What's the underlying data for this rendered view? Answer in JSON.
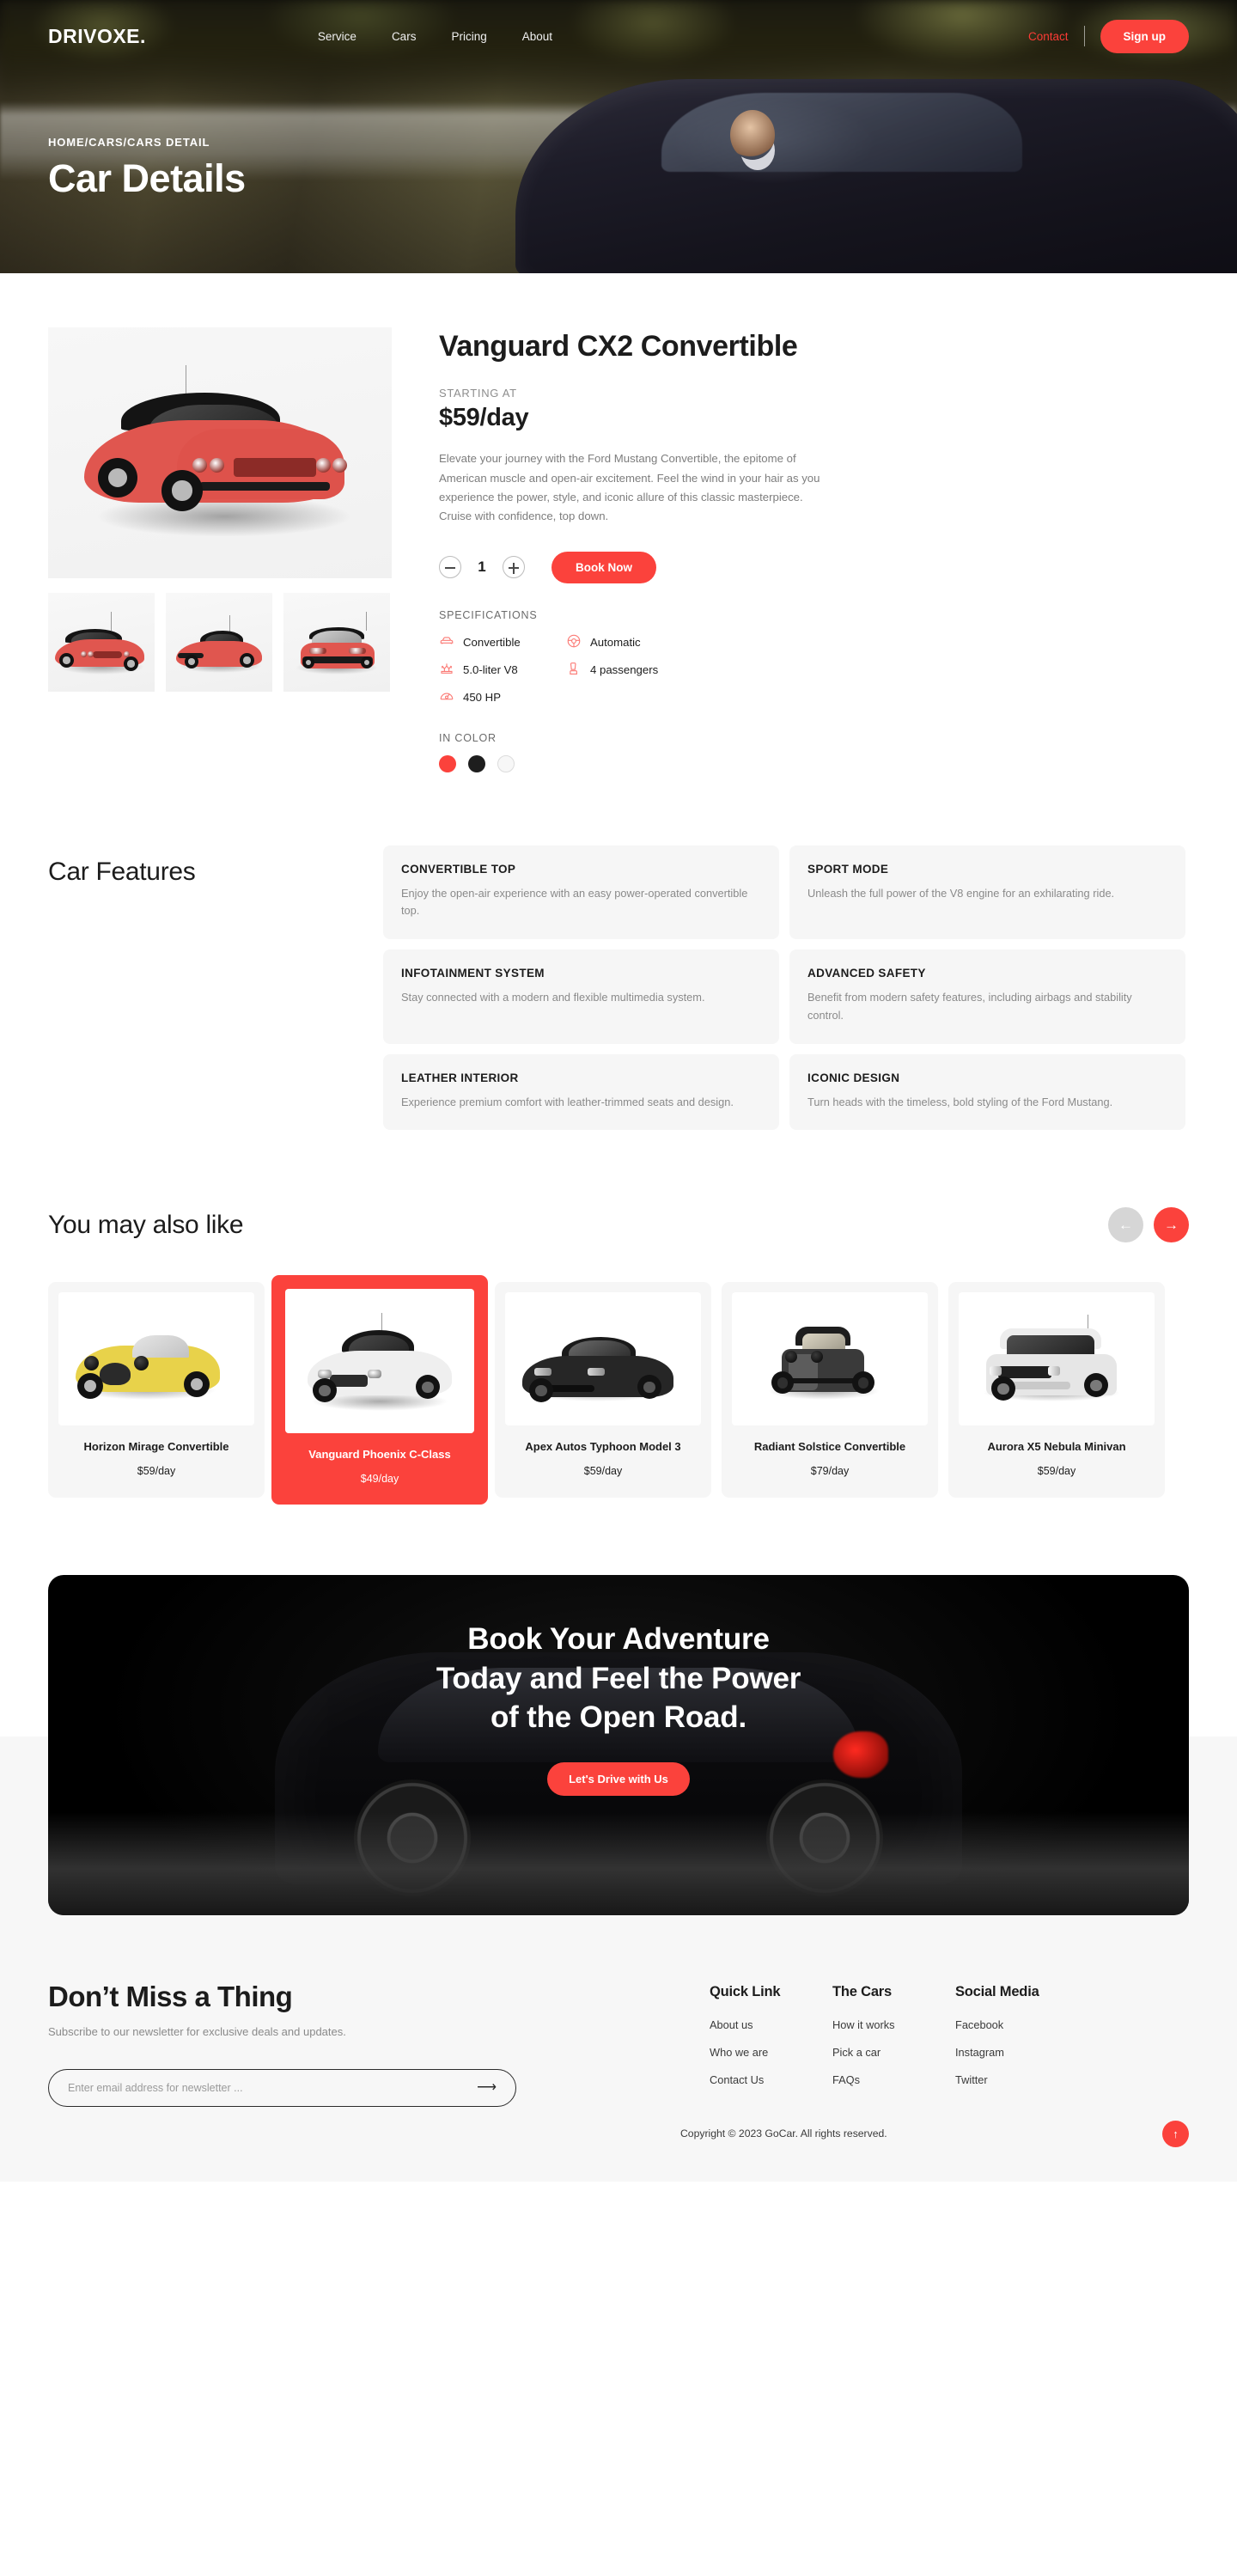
{
  "nav": {
    "logo": "DRIVOXE.",
    "links": [
      {
        "label": "Service"
      },
      {
        "label": "Cars"
      },
      {
        "label": "Pricing"
      },
      {
        "label": "About"
      }
    ],
    "contact_label": "Contact",
    "signup_label": "Sign up"
  },
  "hero": {
    "breadcrumb": "HOME/CARS/CARS DETAIL",
    "title": "Car Details"
  },
  "product": {
    "title": "Vanguard CX2 Convertible",
    "starting_label": "STARTING AT",
    "price": "$59/day",
    "description": "Elevate your journey with the Ford Mustang Convertible, the epitome of American muscle and open-air excitement. Feel the wind in your hair as you experience the power, style, and iconic allure of this classic masterpiece. Cruise with confidence, top down.",
    "quantity": "1",
    "book_label": "Book Now",
    "specs_label": "SPECIFICATIONS",
    "specs": [
      {
        "icon": "car-icon",
        "label": "Convertible"
      },
      {
        "icon": "steering-wheel-icon",
        "label": "Automatic"
      },
      {
        "icon": "engine-icon",
        "label": "5.0-liter V8"
      },
      {
        "icon": "seat-icon",
        "label": "4 passengers"
      },
      {
        "icon": "speedometer-icon",
        "label": "450 HP"
      }
    ],
    "color_label": "IN COLOR",
    "colors": [
      {
        "name": "red",
        "hex": "#FB423C",
        "selected": true
      },
      {
        "name": "black",
        "hex": "#1E1E1E",
        "selected": false
      },
      {
        "name": "white",
        "hex": "#F7F7F7",
        "selected": false
      }
    ]
  },
  "features": {
    "title": "Car Features",
    "items": [
      {
        "title": "CONVERTIBLE TOP",
        "desc": "Enjoy the open-air experience with an easy power-operated convertible top."
      },
      {
        "title": "SPORT MODE",
        "desc": "Unleash the full power of the V8 engine for an exhilarating ride."
      },
      {
        "title": "INFOTAINMENT SYSTEM",
        "desc": "Stay connected with a modern and flexible multimedia system."
      },
      {
        "title": "ADVANCED SAFETY",
        "desc": "Benefit from modern safety features, including airbags and stability control."
      },
      {
        "title": "LEATHER INTERIOR",
        "desc": "Experience premium comfort with leather-trimmed seats and design."
      },
      {
        "title": "ICONIC DESIGN",
        "desc": "Turn heads with the timeless, bold styling of the Ford Mustang."
      }
    ]
  },
  "also_like": {
    "title": "You may also like",
    "prev_icon": "arrow-left-icon",
    "next_icon": "arrow-right-icon",
    "cards": [
      {
        "name": "Horizon Mirage Convertible",
        "price": "$59/day",
        "color": "yellow",
        "active": false
      },
      {
        "name": "Vanguard Phoenix C-Class",
        "price": "$49/day",
        "color": "white",
        "active": true
      },
      {
        "name": "Apex Autos Typhoon Model 3",
        "price": "$59/day",
        "color": "black",
        "active": false
      },
      {
        "name": "Radiant Solstice Convertible",
        "price": "$79/day",
        "color": "vintage",
        "active": false
      },
      {
        "name": "Aurora X5 Nebula Minivan",
        "price": "$59/day",
        "color": "silver",
        "active": false
      }
    ]
  },
  "cta": {
    "line1": "Book Your Adventure",
    "line2": "Today and Feel the Power",
    "line3": "of the Open Road.",
    "button_label": "Let's Drive with Us"
  },
  "footer": {
    "heading": "Don’t Miss a Thing",
    "subheading": "Subscribe to our newsletter for exclusive deals and updates.",
    "newsletter_placeholder": "Enter email address for newsletter ...",
    "newsletter_value": "",
    "submit_icon": "arrow-right-icon",
    "columns": [
      {
        "title": "Quick Link",
        "links": [
          "About us",
          "Who we are",
          "Contact Us"
        ]
      },
      {
        "title": "The Cars",
        "links": [
          "How it works",
          "Pick a car",
          "FAQs"
        ]
      },
      {
        "title": "Social Media",
        "links": [
          "Facebook",
          "Instagram",
          "Twitter"
        ]
      }
    ],
    "copyright": "Copyright © 2023 GoCar. All rights reserved.",
    "back_to_top_icon": "arrow-up-icon"
  },
  "theme": {
    "accent": "#FB423C",
    "surface": "#F6F6F6",
    "footer_bg": "#F7F7F7",
    "text": "#1C1C1C",
    "muted": "#8A8A8A"
  }
}
